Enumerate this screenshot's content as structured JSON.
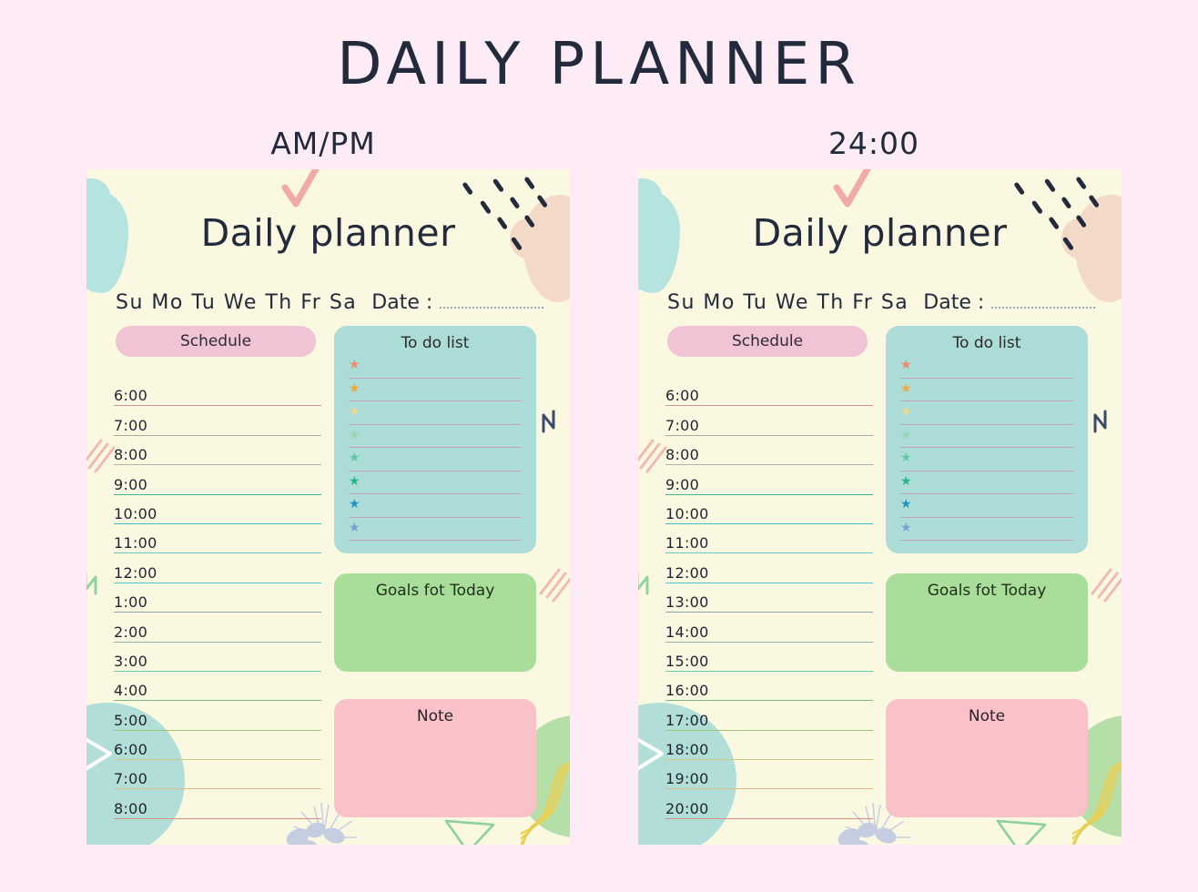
{
  "header": {
    "title": "DAILY PLANNER",
    "left_mode_label": "AM/PM",
    "right_mode_label": "24:00"
  },
  "colors": {
    "page_background": "#fdebf5",
    "card_background": "#fbf8e1",
    "ink": "#222a3c",
    "schedule_pill": "#f0c3d5",
    "todo_box": "#abdcd7",
    "goals_box": "#a9dd9a",
    "note_box": "#f9c2c9"
  },
  "card": {
    "title": "Daily planner",
    "days": "Su Mo Tu We Th Fr Sa",
    "date_label": "Date :",
    "date_value": "",
    "schedule_label": "Schedule",
    "todo_label": "To do list",
    "goals_label": "Goals fot Today",
    "note_label": "Note",
    "goals_value": "",
    "note_value": ""
  },
  "todo_rows": [
    {
      "star_color": "#f08a68",
      "line_color": "#c8a2b6",
      "value": ""
    },
    {
      "star_color": "#f0a83a",
      "line_color": "#c8a2b6",
      "value": ""
    },
    {
      "star_color": "#f4d98a",
      "line_color": "#c8a2b6",
      "value": ""
    },
    {
      "star_color": "#8fd9b0",
      "line_color": "#c8a2b6",
      "value": ""
    },
    {
      "star_color": "#5ec9a2",
      "line_color": "#c8a2b6",
      "value": ""
    },
    {
      "star_color": "#23b98c",
      "line_color": "#c8a2b6",
      "value": ""
    },
    {
      "star_color": "#1d96c4",
      "line_color": "#c8a2b6",
      "value": ""
    },
    {
      "star_color": "#7a9ed8",
      "line_color": "#c8a2b6",
      "value": ""
    }
  ],
  "schedule_ampm": [
    {
      "time": "6:00",
      "line_color": "#c8949b",
      "value": ""
    },
    {
      "time": "7:00",
      "line_color": "#a9a9a9",
      "value": ""
    },
    {
      "time": "8:00",
      "line_color": "#b2b2ae",
      "value": ""
    },
    {
      "time": "9:00",
      "line_color": "#3cb79a",
      "value": ""
    },
    {
      "time": "10:00",
      "line_color": "#3fbfc0",
      "value": ""
    },
    {
      "time": "11:00",
      "line_color": "#63cbc3",
      "value": ""
    },
    {
      "time": "12:00",
      "line_color": "#4cc7cf",
      "value": ""
    },
    {
      "time": "1:00",
      "line_color": "#8fa3ac",
      "value": ""
    },
    {
      "time": "2:00",
      "line_color": "#8fb0b4",
      "value": ""
    },
    {
      "time": "3:00",
      "line_color": "#6fc9a8",
      "value": ""
    },
    {
      "time": "4:00",
      "line_color": "#74b97e",
      "value": ""
    },
    {
      "time": "5:00",
      "line_color": "#9ec47a",
      "value": ""
    },
    {
      "time": "6:00",
      "line_color": "#cfc97a",
      "value": ""
    },
    {
      "time": "7:00",
      "line_color": "#e0b98c",
      "value": ""
    },
    {
      "time": "8:00",
      "line_color": "#dc8d7e",
      "value": ""
    }
  ],
  "schedule_24h": [
    {
      "time": "6:00",
      "line_color": "#c8949b",
      "value": ""
    },
    {
      "time": "7:00",
      "line_color": "#a9a9a9",
      "value": ""
    },
    {
      "time": "8:00",
      "line_color": "#b2b2ae",
      "value": ""
    },
    {
      "time": "9:00",
      "line_color": "#3cb79a",
      "value": ""
    },
    {
      "time": "10:00",
      "line_color": "#3fbfc0",
      "value": ""
    },
    {
      "time": "11:00",
      "line_color": "#63cbc3",
      "value": ""
    },
    {
      "time": "12:00",
      "line_color": "#4cc7cf",
      "value": ""
    },
    {
      "time": "13:00",
      "line_color": "#8fa3ac",
      "value": ""
    },
    {
      "time": "14:00",
      "line_color": "#8fb0b4",
      "value": ""
    },
    {
      "time": "15:00",
      "line_color": "#6fc9a8",
      "value": ""
    },
    {
      "time": "16:00",
      "line_color": "#74b97e",
      "value": ""
    },
    {
      "time": "17:00",
      "line_color": "#9ec47a",
      "value": ""
    },
    {
      "time": "18:00",
      "line_color": "#cfc97a",
      "value": ""
    },
    {
      "time": "19:00",
      "line_color": "#e0b98c",
      "value": ""
    },
    {
      "time": "20:00",
      "line_color": "#dc8d7e",
      "value": ""
    }
  ],
  "decorations": {
    "blob_aqua": "#b5e3e0",
    "blob_peach": "#f2d9c8",
    "circle_teal": "#b2ded9",
    "circle_green": "#b6dfa8",
    "check_pink": "#f0aaa8",
    "stripe_pink": "#f0b9b2",
    "zigzag_green": "#8fd3a0",
    "zigzag_navy": "#3a4a6b",
    "triangle_green": "#8ccfa0",
    "waves_yellow": "#e8cf55",
    "floral_blue": "#b9c4e0"
  }
}
